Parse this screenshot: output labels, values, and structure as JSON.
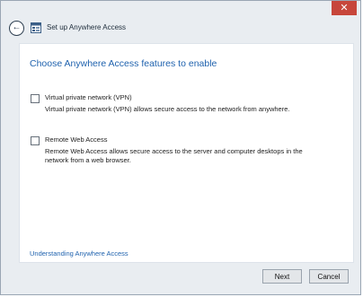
{
  "window": {
    "close_glyph": "✕"
  },
  "nav": {
    "back_glyph": "←",
    "title": "Set up Anywhere Access"
  },
  "content": {
    "heading": "Choose Anywhere Access features to enable",
    "options": [
      {
        "label": "Virtual private network (VPN)",
        "description": "Virtual private network (VPN) allows secure access to the network from anywhere.",
        "checked": false
      },
      {
        "label": "Remote Web Access",
        "description": "Remote Web Access allows secure access to the server and computer desktops in the network from a web browser.",
        "checked": false
      }
    ],
    "help_link": "Understanding Anywhere Access"
  },
  "footer": {
    "next_label": "Next",
    "cancel_label": "Cancel"
  },
  "colors": {
    "accent": "#1f62ae",
    "close_button": "#c7463b"
  },
  "icons": {
    "back": "back-arrow-icon",
    "wizard": "wizard-icon",
    "close": "close-icon"
  }
}
